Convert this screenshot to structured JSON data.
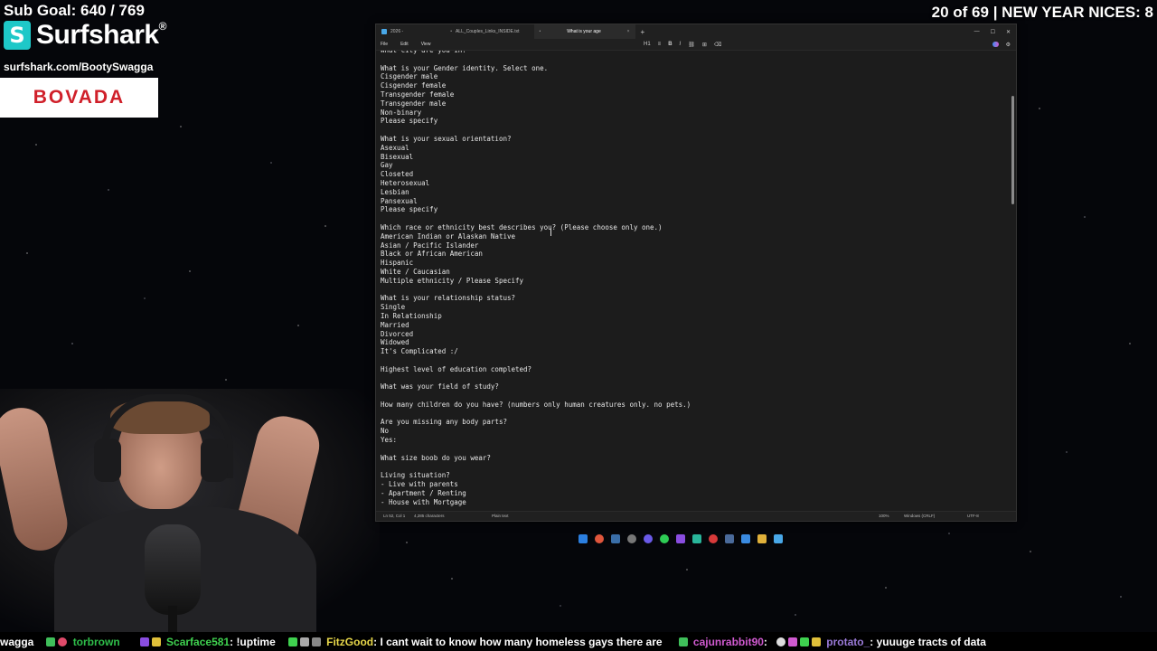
{
  "overlay": {
    "sub_goal": "Sub Goal: 640 / 769",
    "brand_name": "Surfshark",
    "brand_mark": "S",
    "brand_registered": "®",
    "promo_url": "surfshark.com/BootySwagga",
    "sponsor": "BOVADA",
    "counter": "20 of 69 | NEW YEAR NICES: 8"
  },
  "window": {
    "tabs": [
      {
        "label": "2026 -",
        "active": false,
        "close": "•"
      },
      {
        "label": "ALL_Couples_Links_INSIDE.txt",
        "active": false,
        "close": "•"
      },
      {
        "label": "What is your age",
        "active": true,
        "close": "×"
      }
    ],
    "new_tab": "+",
    "controls": {
      "minimize": "—",
      "maximize": "☐",
      "close": "✕"
    },
    "menu": [
      "File",
      "Edit",
      "View"
    ],
    "toolbar": {
      "heading": "H1",
      "list": "≡",
      "bold": "B",
      "italic": "I",
      "link": "⛓",
      "table": "⊞",
      "clear": "⌫"
    },
    "settings_icon": "⚙",
    "lines": [
      "What city are you in?",
      "",
      "What is your Gender identity. Select one.",
      "Cisgender male",
      "Cisgender female",
      "Transgender female",
      "Transgender male",
      "Non-binary",
      "Please specify",
      "",
      "What is your sexual orientation?",
      "Asexual",
      "Bisexual",
      "Gay",
      "Closeted",
      "Heterosexual",
      "Lesbian",
      "Pansexual",
      "Please specify",
      "",
      "Which race or ethnicity best describes you? (Please choose only one.)",
      "American Indian or Alaskan Native",
      "Asian / Pacific Islander",
      "Black or African American",
      "Hispanic",
      "White / Caucasian",
      "Multiple ethnicity / Please Specify",
      "",
      "What is your relationship status?",
      "Single",
      "In Relationship",
      "Married",
      "Divorced",
      "Widowed",
      "It's Complicated :/",
      "",
      "Highest level of education completed?",
      "",
      "What was your field of study?",
      "",
      "How many children do you have? (numbers only human creatures only. no pets.)",
      "",
      "Are you missing any body parts?",
      "No",
      "Yes:",
      "",
      "What size boob do you wear?",
      "",
      "Living situation?",
      "- Live with parents",
      "- Apartment / Renting",
      "- House with Mortgage"
    ],
    "status": {
      "position": "Ln 52, Col 1",
      "characters": "4,285 characters",
      "format": "Plain text",
      "zoom": "100%",
      "line_ending": "Windows (CRLF)",
      "encoding": "UTF-8"
    }
  },
  "chat": [
    {
      "user": "wagga",
      "color": "#ffffff",
      "text": ""
    },
    {
      "user": "torbrown",
      "color": "#2fbf4a",
      "text": ""
    },
    {
      "user": "Scarface581",
      "color": "#3fd14f",
      "text": "!uptime"
    },
    {
      "user": "FitzGood",
      "color": "#e8d84a",
      "text": "I cant wait to know how many homeless gays there are"
    },
    {
      "user": "cajunrabbit90",
      "color": "#d05ad0",
      "text": ""
    },
    {
      "user": "protato_",
      "color": "#9a7ad8",
      "text": "yuuuge tracts of data"
    }
  ]
}
